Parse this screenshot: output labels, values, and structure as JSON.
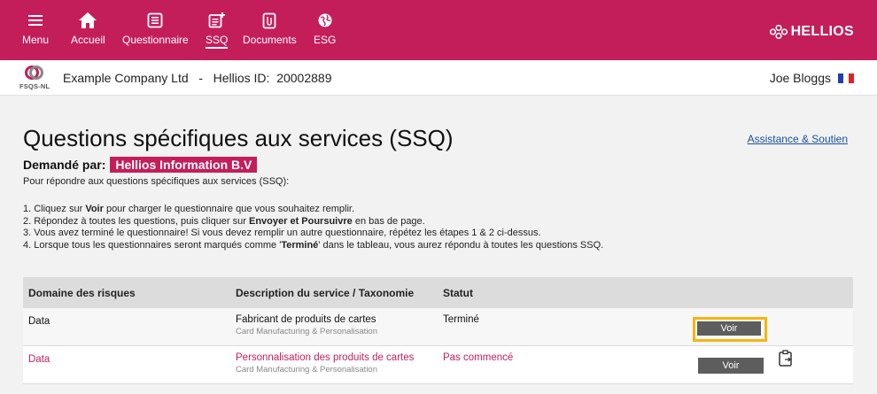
{
  "nav": {
    "items": [
      {
        "label": "Menu",
        "icon": "hamburger-icon"
      },
      {
        "label": "Accueil",
        "icon": "home-icon"
      },
      {
        "label": "Questionnaire",
        "icon": "form-icon"
      },
      {
        "label": "SSQ",
        "icon": "ssq-icon"
      },
      {
        "label": "Documents",
        "icon": "document-icon"
      },
      {
        "label": "ESG",
        "icon": "globe-icon"
      }
    ],
    "active": "SSQ",
    "brand": "HELLIOS"
  },
  "company_bar": {
    "logo_text": "FSQS-NL",
    "company_line": "Example Company Ltd   -   Hellios ID:  20002889",
    "user": "Joe Bloggs"
  },
  "page": {
    "title": "Questions spécifiques aux services (SSQ)",
    "help_link": "Assistance & Soutien",
    "requested_label": "Demandé par:",
    "requested_by": "Hellios Information B.V",
    "intro": "Pour répondre aux questions spécifiques aux services (SSQ):",
    "steps": [
      {
        "pre": "1. Cliquez sur ",
        "bold": "Voir",
        "post": " pour charger le questionnaire que vous souhaitez remplir."
      },
      {
        "pre": "2. Répondez à toutes les questions, puis cliquer sur ",
        "bold": "Envoyer et Poursuivre",
        "post": " en bas de page."
      },
      {
        "pre": "3. Vous avez terminé le questionnaire! Si vous devez remplir un autre questionnaire, répétez les étapes 1 & 2 ci-dessus.",
        "bold": "",
        "post": ""
      },
      {
        "pre": "4. Lorsque tous les questionnaires seront marqués comme '",
        "bold": "Terminé",
        "post": "' dans le tableau, vous aurez répondu à toutes les questions SSQ."
      }
    ]
  },
  "table": {
    "headers": {
      "domain": "Domaine des risques",
      "description": "Description du service / Taxonomie",
      "status": "Statut"
    },
    "rows": [
      {
        "domain": "Data",
        "description": "Fabricant de produits de cartes",
        "taxonomy": "Card Manufacturing & Personalisation",
        "status": "Terminé",
        "action": "Voir"
      },
      {
        "domain": "Data",
        "description": "Personnalisation des produits de cartes",
        "taxonomy": "Card Manufacturing & Personalisation",
        "status": "Pas commencé",
        "action": "Voir"
      }
    ]
  },
  "colors": {
    "brand": "#c41e5a",
    "highlight": "#f6b50e",
    "button": "#5d5d5d"
  }
}
